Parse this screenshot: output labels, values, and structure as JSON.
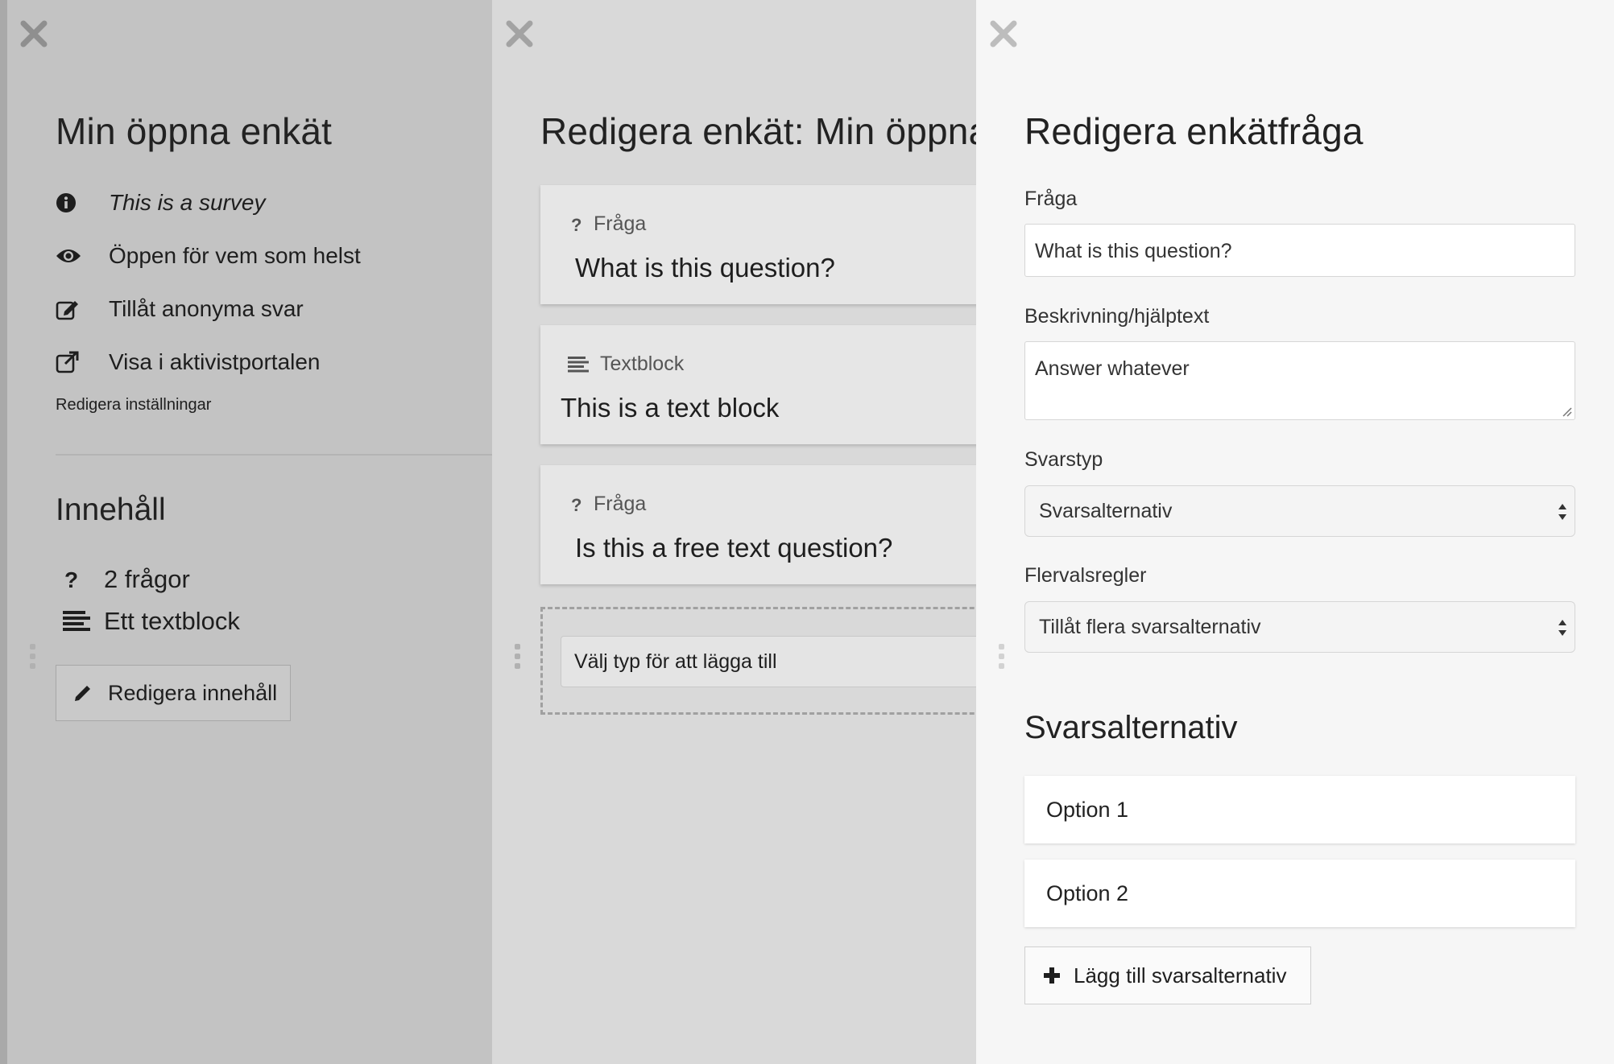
{
  "survey_panel": {
    "title": "Min öppna enkät",
    "info": [
      {
        "icon": "info-icon",
        "text": "This is a survey"
      },
      {
        "icon": "eye-icon",
        "text": "Öppen för vem som helst"
      },
      {
        "icon": "edit-icon",
        "text": "Tillåt anonyma svar"
      },
      {
        "icon": "external-link-icon",
        "text": "Visa i aktivistportalen"
      }
    ],
    "edit_settings_label": "Redigera inställningar",
    "content_heading": "Innehåll",
    "counts": [
      {
        "icon": "question-icon",
        "text": "2 frågor"
      },
      {
        "icon": "text-block-icon",
        "text": "Ett textblock"
      }
    ],
    "edit_content_label": "Redigera innehåll"
  },
  "content_panel": {
    "title": "Redigera enkät: Min öppna enkät",
    "cards": [
      {
        "type": "Fråga",
        "icon": "question-icon",
        "text": "What is this question?"
      },
      {
        "type": "Textblock",
        "icon": "text-block-icon",
        "text": "This is a text block"
      },
      {
        "type": "Fråga",
        "icon": "question-icon",
        "text": "Is this a free text question?"
      }
    ],
    "add_placeholder": "Välj typ för att lägga till"
  },
  "question_panel": {
    "title": "Redigera enkätfråga",
    "question_label": "Fråga",
    "question_value": "What is this question?",
    "description_label": "Beskrivning/hjälptext",
    "description_value": "Answer whatever",
    "answer_type_label": "Svarstyp",
    "answer_type_value": "Svarsalternativ",
    "multi_rules_label": "Flervalsregler",
    "multi_rules_value": "Tillåt flera svarsalternativ",
    "options_heading": "Svarsalternativ",
    "options": [
      "Option 1",
      "Option 2"
    ],
    "add_option_label": "Lägg till svarsalternativ"
  }
}
